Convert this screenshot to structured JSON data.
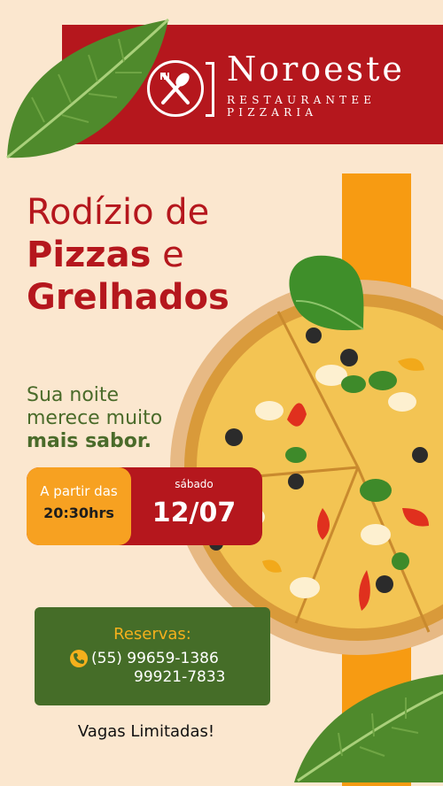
{
  "brand": {
    "name": "Noroeste",
    "subtitle_line1": "RESTAURANTEE",
    "subtitle_line2": "PIZZARIA"
  },
  "headline": {
    "line1": "Rodízio de",
    "line2_bold": "Pizzas",
    "line2_rest": " e",
    "line3": "Grelhados"
  },
  "tagline": {
    "line1": "Sua noite",
    "line2": "merece muito",
    "line3_bold": "mais sabor."
  },
  "schedule": {
    "time_label": "A partir das",
    "time_value": "20:30hrs",
    "day_label": "sábado",
    "day_value": "12/07"
  },
  "reservations": {
    "title": "Reservas:",
    "phone_line1": "(55) 99659-1386",
    "phone_line2": "99921-7833"
  },
  "footer": {
    "vagas": "Vagas Limitadas!"
  },
  "icons": [
    "leaf-icon",
    "fork-knife-icon",
    "phone-icon"
  ],
  "colors": {
    "background": "#fbe7cf",
    "brand_red": "#b5171d",
    "orange": "#f79b12",
    "green": "#456d28",
    "gold": "#f4b01c"
  }
}
